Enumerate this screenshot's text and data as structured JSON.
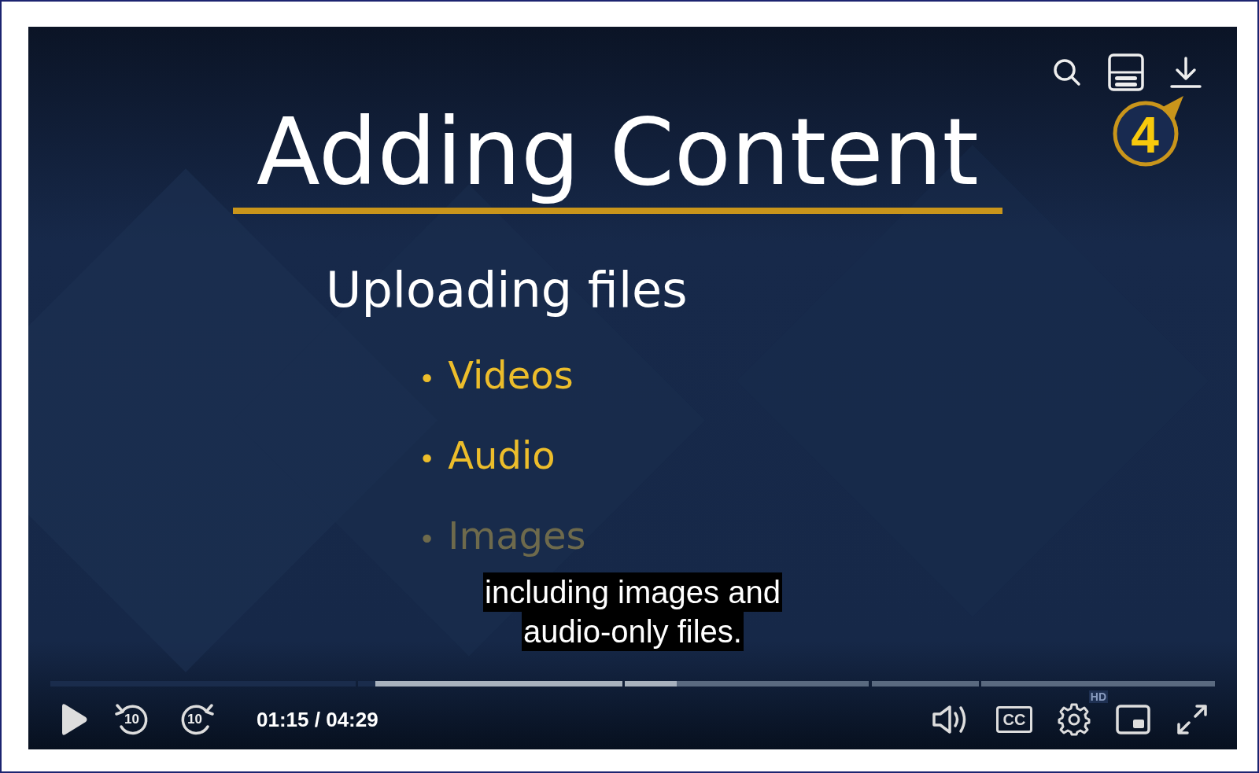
{
  "slide": {
    "title": "Adding Content",
    "heading": "Uploading files",
    "bullets": [
      {
        "bullet": "•",
        "text": "Videos",
        "faded": false
      },
      {
        "bullet": "•",
        "text": "Audio",
        "faded": false
      },
      {
        "bullet": "•",
        "text": "Images",
        "faded": true
      }
    ]
  },
  "top_controls": [
    {
      "kind": "search"
    },
    {
      "kind": "transcript"
    },
    {
      "kind": "download"
    }
  ],
  "callout": {
    "number": "4"
  },
  "captions": [
    "including images and",
    "audio-only files."
  ],
  "progress": {
    "level": 0.279
  },
  "buffer": {
    "level": 0.538
  },
  "controls": {
    "time": "01:15 / 04:29",
    "quality": "HD",
    "left": [
      {
        "kind": "play"
      },
      {
        "kind": "rewind",
        "label": "10"
      },
      {
        "kind": "forward",
        "label": "10"
      }
    ],
    "right": [
      {
        "kind": "volume"
      },
      {
        "kind": "captions",
        "label": "CC"
      },
      {
        "kind": "settings"
      },
      {
        "kind": "pip"
      },
      {
        "kind": "fullscreen"
      }
    ]
  }
}
